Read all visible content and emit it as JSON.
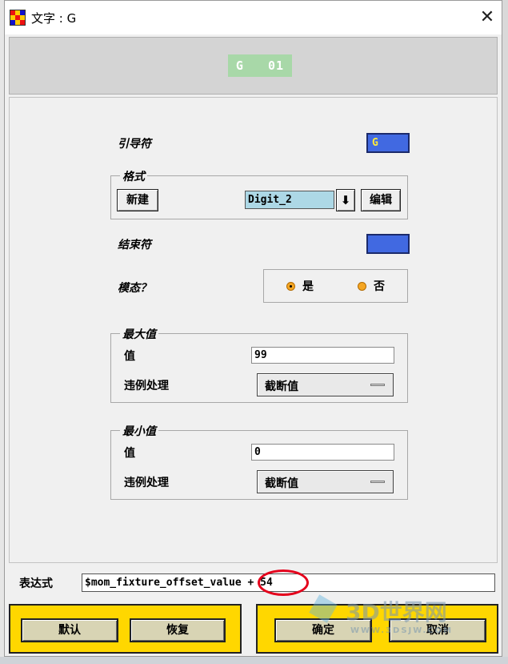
{
  "window": {
    "title": "文字 : G",
    "close_glyph": "✕"
  },
  "preview": {
    "text": "G   01"
  },
  "leader": {
    "label": "引导符",
    "value": "G",
    "color": "#4169e1"
  },
  "format_group": {
    "title": "格式",
    "new_label": "新建",
    "format_value": "Digit_2",
    "dropdown_glyph": "⬇",
    "edit_label": "编辑"
  },
  "trailer": {
    "label": "结束符",
    "color": "#4169e1"
  },
  "modal": {
    "label": "模态？",
    "options": [
      "是",
      "否"
    ],
    "selected": "是"
  },
  "max_group": {
    "title": "最大值",
    "value_label": "值",
    "value": "99",
    "violation_label": "违例处理",
    "violation_value": "截断值"
  },
  "min_group": {
    "title": "最小值",
    "value_label": "值",
    "value": "0",
    "violation_label": "违例处理",
    "violation_value": "截断值"
  },
  "expression": {
    "label": "表达式",
    "value": "$mom_fixture_offset_value + 54"
  },
  "footer": {
    "default_label": "默认",
    "restore_label": "恢复",
    "ok_label": "确定",
    "cancel_label": "取消"
  },
  "watermark": {
    "text": "3D世界网",
    "url_text": "WWW.3DSJW.COM"
  },
  "colors": {
    "panel_yellow": "#ffd700",
    "preview_green": "#a8d8a8",
    "highlight_red": "#e4001b"
  }
}
